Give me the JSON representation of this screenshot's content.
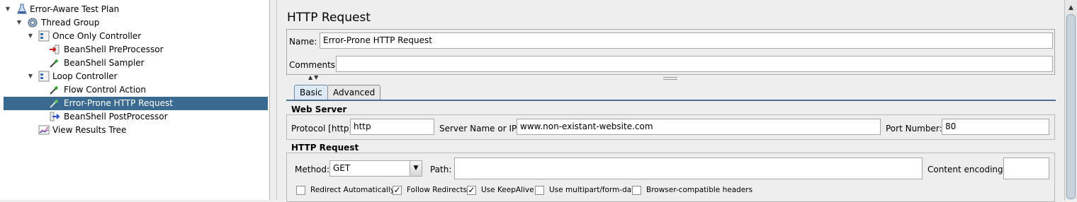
{
  "tree": {
    "items": [
      {
        "label": "Error-Aware Test Plan",
        "icon": "flask-icon",
        "expanded": true
      },
      {
        "label": "Thread Group",
        "icon": "gear-icon",
        "expanded": true
      },
      {
        "label": "Once Only Controller",
        "icon": "controller-icon",
        "expanded": true
      },
      {
        "label": "BeanShell PreProcessor",
        "icon": "preprocessor-icon"
      },
      {
        "label": "BeanShell Sampler",
        "icon": "pipette-icon"
      },
      {
        "label": "Loop Controller",
        "icon": "controller-icon",
        "expanded": true
      },
      {
        "label": "Flow Control Action",
        "icon": "pipette-icon"
      },
      {
        "label": "Error-Prone HTTP Request",
        "icon": "pipette-icon",
        "selected": true
      },
      {
        "label": "BeanShell PostProcessor",
        "icon": "postprocessor-icon"
      },
      {
        "label": "View Results Tree",
        "icon": "graph-icon"
      }
    ]
  },
  "panel": {
    "title": "HTTP Request",
    "name_label": "Name:",
    "name_value": "Error-Prone HTTP Request",
    "comments_label": "Comments:",
    "comments_value": "",
    "tabs": [
      "Basic",
      "Advanced"
    ],
    "active_tab": "Basic"
  },
  "web_server": {
    "title": "Web Server",
    "protocol_label": "Protocol [http]:",
    "protocol_value": "http",
    "server_label": "Server Name or IP:",
    "server_value": "www.non-existant-website.com",
    "port_label": "Port Number:",
    "port_value": "80"
  },
  "http_request": {
    "title": "HTTP Request",
    "method_label": "Method:",
    "method_value": "GET",
    "path_label": "Path:",
    "path_value": "",
    "encoding_label": "Content encoding:",
    "encoding_value": "",
    "options": [
      {
        "label": "Redirect Automatically",
        "checked": false
      },
      {
        "label": "Follow Redirects",
        "checked": true
      },
      {
        "label": "Use KeepAlive",
        "checked": true
      },
      {
        "label": "Use multipart/form-data",
        "checked": false
      },
      {
        "label": "Browser-compatible headers",
        "checked": false
      }
    ]
  },
  "colors": {
    "selection": "#3a6a8f",
    "tab_rule": "#4d6f8f"
  }
}
